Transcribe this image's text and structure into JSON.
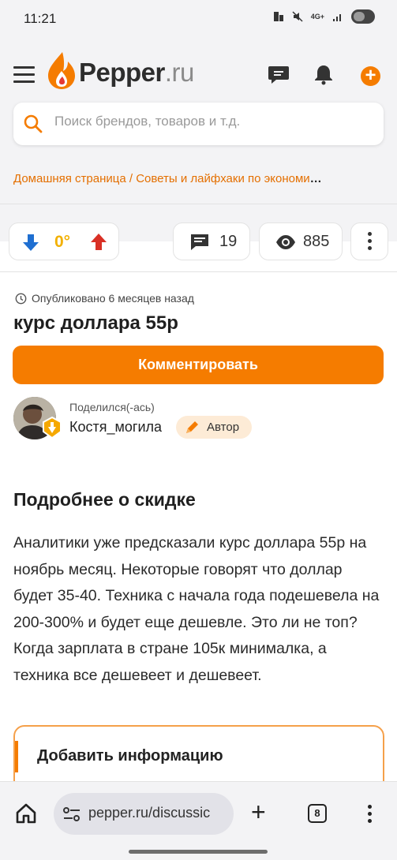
{
  "status_bar": {
    "time": "11:21",
    "network": "4G+"
  },
  "header": {
    "logo_main": "Pepper",
    "logo_suffix": ".ru",
    "search_placeholder": "Поиск брендов, товаров и т.д.",
    "search_value": "",
    "breadcrumb": "Домашняя страница / Советы и лайфхаки по экономи",
    "breadcrumb_ellipsis": "…"
  },
  "stats": {
    "temperature": "0°",
    "comments": "19",
    "views": "885"
  },
  "post": {
    "published": "Опубликовано 6 месяцев назад",
    "title": "курс доллара 55р",
    "comment_button": "Комментировать",
    "shared_label": "Поделился(-ась)",
    "username": "Костя_могила",
    "author_badge": "Автор",
    "section_heading": "Подробнее о скидке",
    "description": "Аналитики уже предсказали курс доллара 55р на ноябрь месяц. Некоторые говорят что доллар будет 35-40. Техника с начала года подешевела на 200-300% и будет еще дешевле. Это ли не топ? Когда зарплата в стране 105к минималка, а техника все дешевеет и дешевеет.",
    "add_info_title": "Добавить информацию"
  },
  "browser": {
    "url": "pepper.ru/discussic",
    "tabs_count": "8"
  },
  "colors": {
    "brand_orange": "#f57c00",
    "temperature_yellow": "#f2b000",
    "vote_down_blue": "#1f6fd1",
    "vote_up_red": "#d93025"
  }
}
